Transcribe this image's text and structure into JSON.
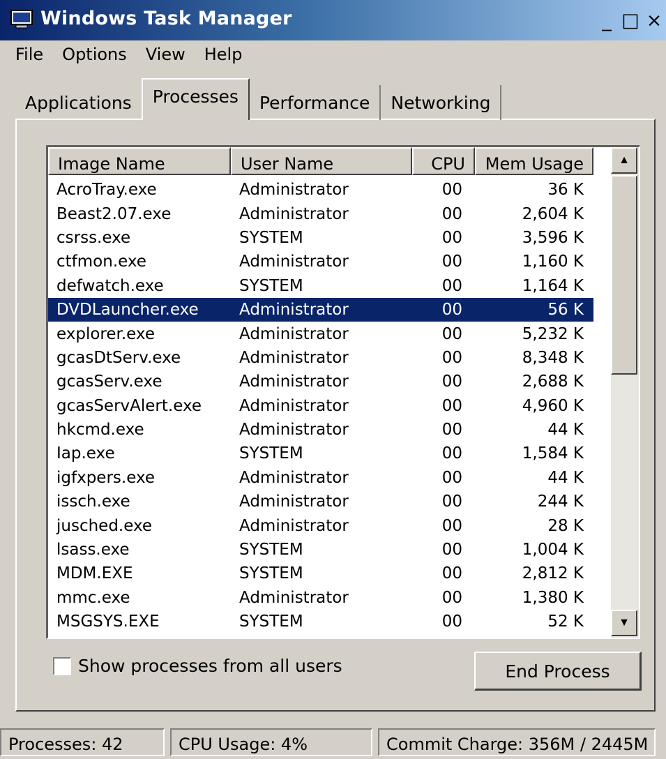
{
  "window": {
    "title": "Windows Task Manager",
    "controls": {
      "minimize": "_",
      "maximize": "□",
      "close": "×"
    }
  },
  "menu": [
    "File",
    "Options",
    "View",
    "Help"
  ],
  "tabs": [
    {
      "label": "Applications",
      "active": false
    },
    {
      "label": "Processes",
      "active": true
    },
    {
      "label": "Performance",
      "active": false
    },
    {
      "label": "Networking",
      "active": false
    }
  ],
  "process_list": {
    "columns": [
      "Image Name",
      "User Name",
      "CPU",
      "Mem Usage"
    ],
    "rows": [
      {
        "image": "AcroTray.exe",
        "user": "Administrator",
        "cpu": "00",
        "mem": "36 K"
      },
      {
        "image": "Beast2.07.exe",
        "user": "Administrator",
        "cpu": "00",
        "mem": "2,604 K"
      },
      {
        "image": "csrss.exe",
        "user": "SYSTEM",
        "cpu": "00",
        "mem": "3,596 K"
      },
      {
        "image": "ctfmon.exe",
        "user": "Administrator",
        "cpu": "00",
        "mem": "1,160 K"
      },
      {
        "image": "defwatch.exe",
        "user": "SYSTEM",
        "cpu": "00",
        "mem": "1,164 K"
      },
      {
        "image": "DVDLauncher.exe",
        "user": "Administrator",
        "cpu": "00",
        "mem": "56 K",
        "selected": true
      },
      {
        "image": "explorer.exe",
        "user": "Administrator",
        "cpu": "00",
        "mem": "5,232 K"
      },
      {
        "image": "gcasDtServ.exe",
        "user": "Administrator",
        "cpu": "00",
        "mem": "8,348 K"
      },
      {
        "image": "gcasServ.exe",
        "user": "Administrator",
        "cpu": "00",
        "mem": "2,688 K"
      },
      {
        "image": "gcasServAlert.exe",
        "user": "Administrator",
        "cpu": "00",
        "mem": "4,960 K"
      },
      {
        "image": "hkcmd.exe",
        "user": "Administrator",
        "cpu": "00",
        "mem": "44 K"
      },
      {
        "image": "Iap.exe",
        "user": "SYSTEM",
        "cpu": "00",
        "mem": "1,584 K"
      },
      {
        "image": "igfxpers.exe",
        "user": "Administrator",
        "cpu": "00",
        "mem": "44 K"
      },
      {
        "image": "issch.exe",
        "user": "Administrator",
        "cpu": "00",
        "mem": "244 K"
      },
      {
        "image": "jusched.exe",
        "user": "Administrator",
        "cpu": "00",
        "mem": "28 K"
      },
      {
        "image": "lsass.exe",
        "user": "SYSTEM",
        "cpu": "00",
        "mem": "1,004 K"
      },
      {
        "image": "MDM.EXE",
        "user": "SYSTEM",
        "cpu": "00",
        "mem": "2,812 K"
      },
      {
        "image": "mmc.exe",
        "user": "Administrator",
        "cpu": "00",
        "mem": "1,380 K"
      },
      {
        "image": "MSGSYS.EXE",
        "user": "SYSTEM",
        "cpu": "00",
        "mem": "52 K"
      }
    ]
  },
  "show_all_users": {
    "label": "Show processes from all users",
    "checked": false
  },
  "end_process_label": "End Process",
  "status": {
    "processes": "Processes: 42",
    "cpu_usage": "CPU Usage: 4%",
    "commit_charge": "Commit Charge: 356M / 2445M"
  },
  "colors": {
    "selection": "#0a246a",
    "face": "#d4d0c8"
  }
}
